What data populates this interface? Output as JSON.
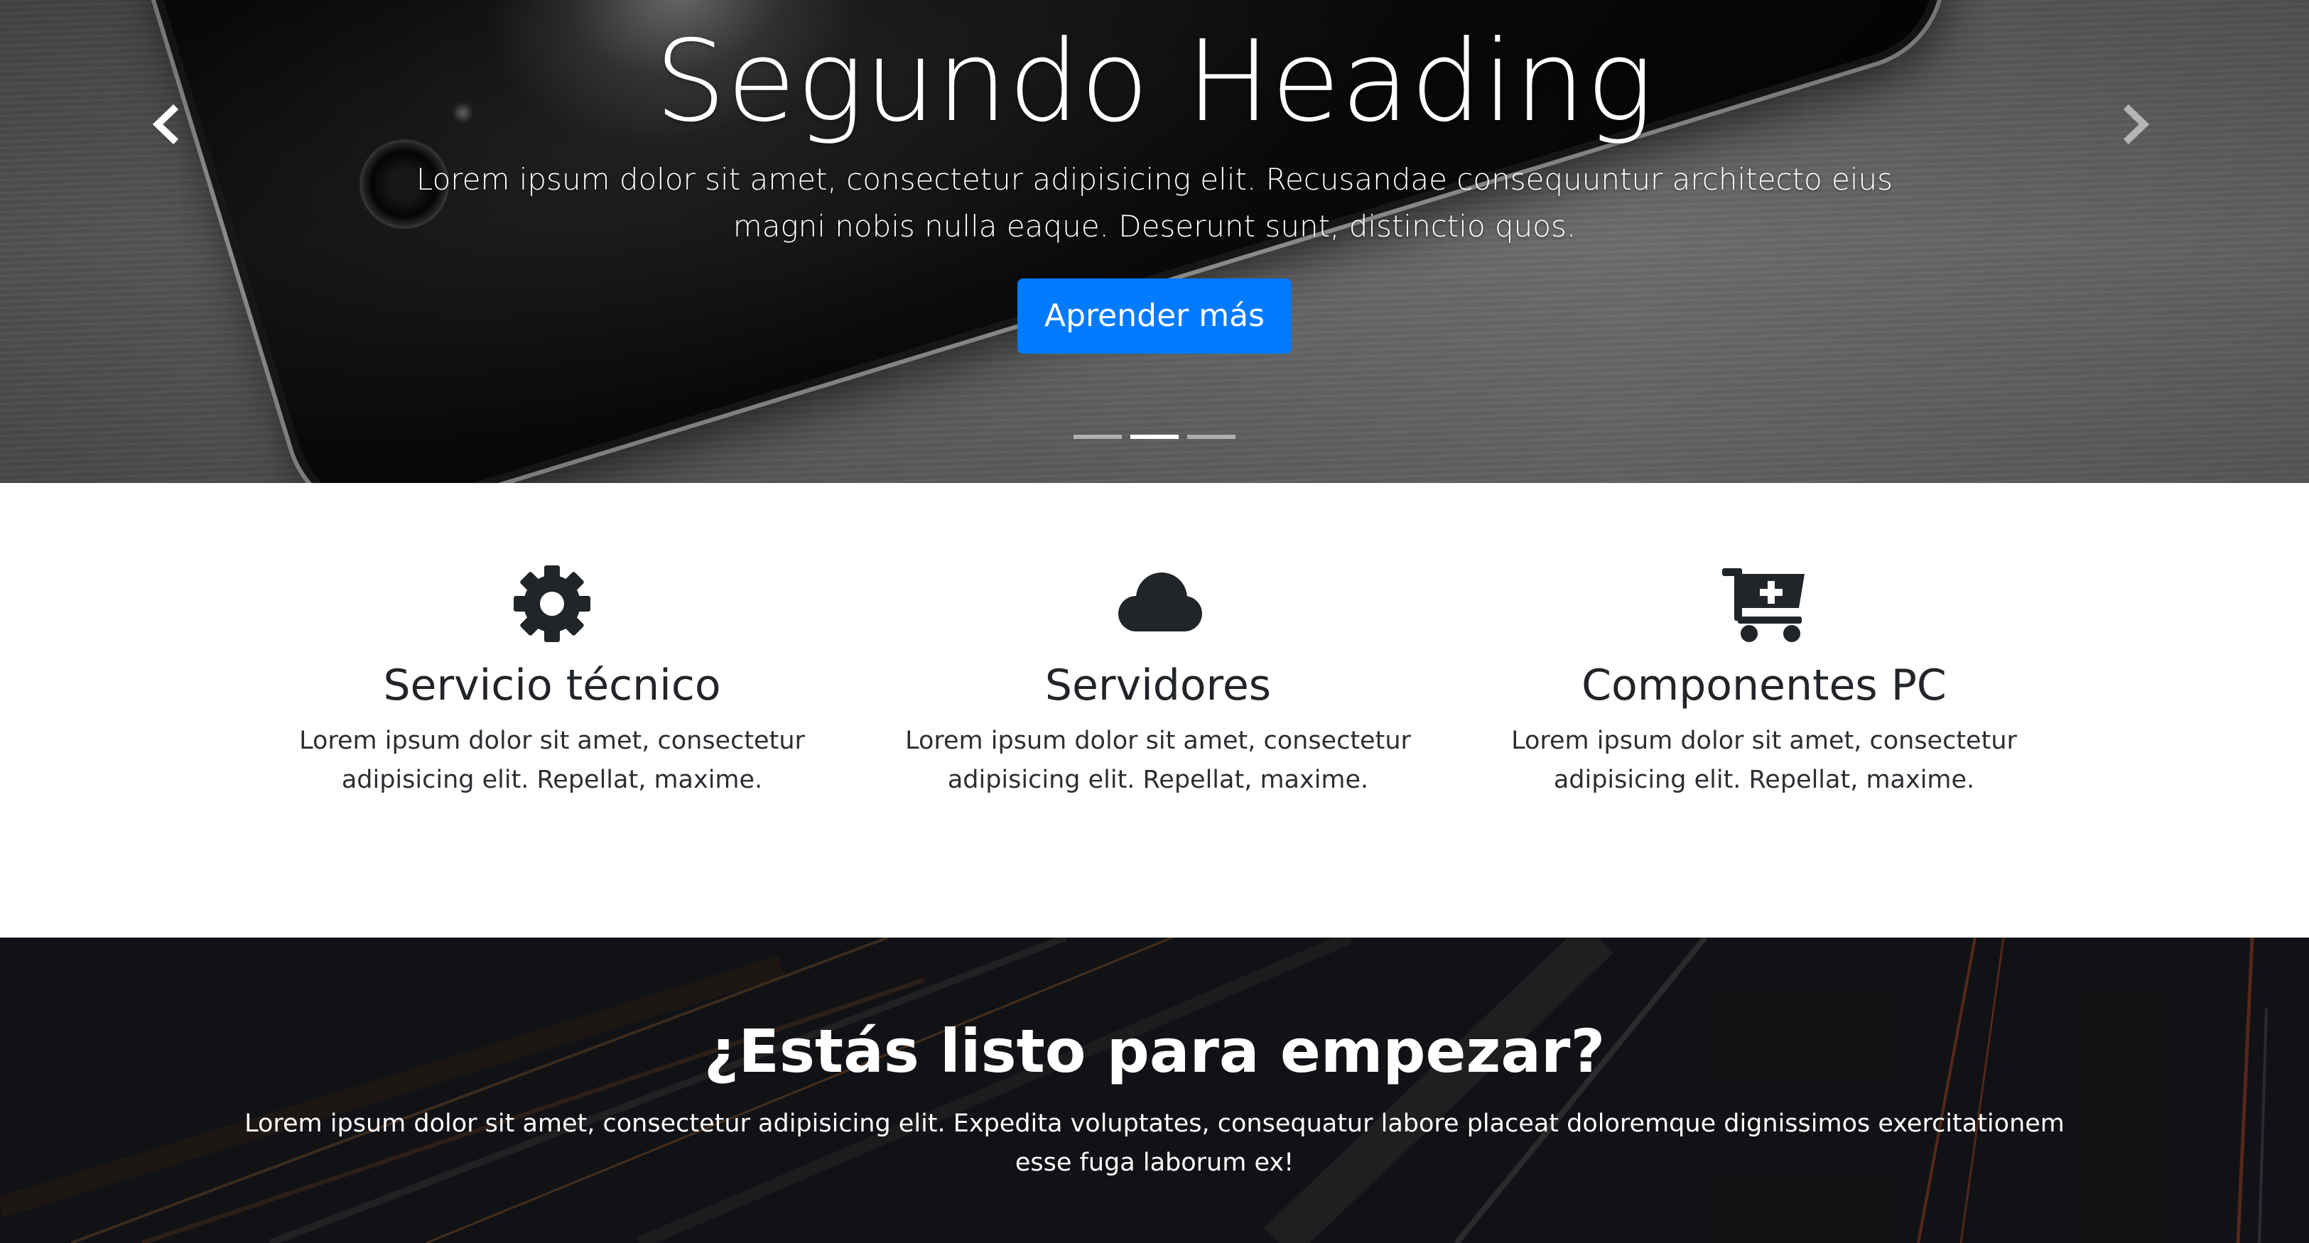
{
  "hero": {
    "title": "Segundo Heading",
    "text": "Lorem ipsum dolor sit amet, consectetur adipisicing elit. Recusandae consequuntur architecto eius magni nobis nulla eaque. Deserunt sunt, distinctio quos.",
    "button_label": "Aprender más",
    "prev_icon": "chevron-left-icon",
    "next_icon": "chevron-right-icon",
    "slides_count": 3,
    "active_slide": 2,
    "button_color": "#007bff"
  },
  "features": [
    {
      "icon": "gear-icon",
      "title": "Servicio técnico",
      "text": "Lorem ipsum dolor sit amet, consectetur adipisicing elit. Repellat, maxime."
    },
    {
      "icon": "cloud-icon",
      "title": "Servidores",
      "text": "Lorem ipsum dolor sit amet, consectetur adipisicing elit. Repellat, maxime."
    },
    {
      "icon": "cart-plus-icon",
      "title": "Componentes PC",
      "text": "Lorem ipsum dolor sit amet, consectetur adipisicing elit. Repellat, maxime."
    }
  ],
  "cta": {
    "title": "¿Estás listo para empezar?",
    "text": "Lorem ipsum dolor sit amet, consectetur adipisicing elit. Expedita voluptates, consequatur labore placeat doloremque dignissimos exercitationem esse fuga laborum ex!"
  }
}
